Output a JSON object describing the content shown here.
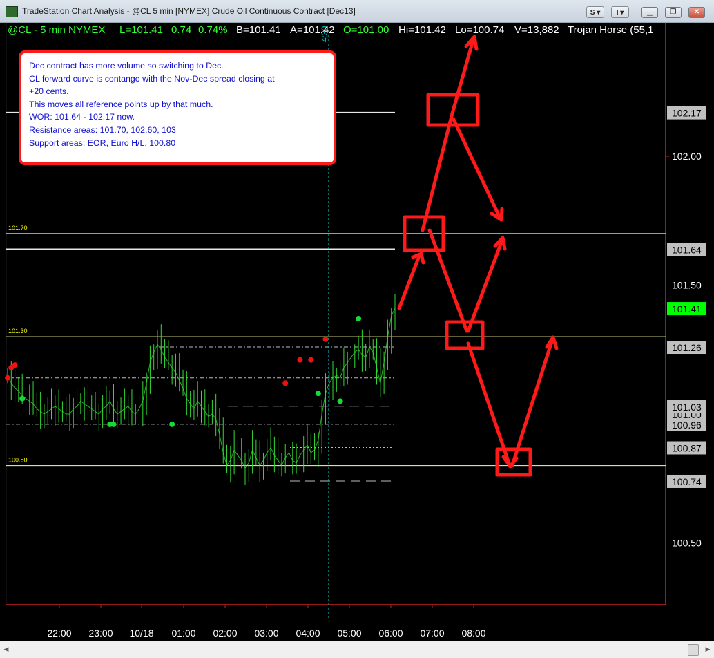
{
  "window": {
    "title": "TradeStation Chart Analysis - @CL 5 min [NYMEX] Crude Oil Continuous Contract [Dec13]",
    "s_button": "S",
    "i_button": "I"
  },
  "status_line": {
    "symbol": "@CL - 5 min  NYMEX",
    "last": "L=101.41",
    "change": "0.74",
    "change_pct": "0.74%",
    "bid": "B=101.41",
    "ask": "A=101.42",
    "open": "O=101.00",
    "high": "Hi=101.42",
    "low": "Lo=100.74",
    "volume": "V=13,882",
    "indicator": "Trojan Horse (55,1"
  },
  "note": {
    "lines": [
      "Dec contract has more volume so switching to Dec.",
      "CL forward curve is contango with the Nov-Dec spread closing at",
      "+20 cents.",
      "This moves all reference points up by that much.",
      "WOR: 101.64 - 102.17 now.",
      "Resistance areas: 101.70, 102.60, 103",
      "Support areas: EOR, Euro H/L, 100.80"
    ]
  },
  "colors": {
    "bars": "#33dd33",
    "annotation": "#ff1111",
    "level_line": "#ffff99",
    "ref_line": "#ffffff",
    "note_text": "#1010d0",
    "last_price_bg": "#00ff00",
    "time_line": "#00cccc"
  },
  "chart_data": {
    "type": "line",
    "x": [
      "22:00",
      "23:00",
      "10/18",
      "01:00",
      "02:00",
      "03:00",
      "04:00",
      "05:00",
      "06:00",
      "07:00",
      "08:00"
    ],
    "y_ticks": [
      "102.00",
      "101.50",
      "100.50"
    ],
    "ylim": [
      100.2,
      102.4
    ],
    "price_labels": [
      {
        "value": 102.17,
        "text": "102.17",
        "style": "gray"
      },
      {
        "value": 101.64,
        "text": "101.64",
        "style": "gray"
      },
      {
        "value": 101.41,
        "text": "101.41",
        "style": "green"
      },
      {
        "value": 101.26,
        "text": "101.26",
        "style": "gray"
      },
      {
        "value": 101.0,
        "text": "101.00",
        "style": "gray"
      },
      {
        "value": 101.03,
        "text": "101.03",
        "style": "gray"
      },
      {
        "value": 100.96,
        "text": "100.96",
        "style": "gray"
      },
      {
        "value": 100.87,
        "text": "100.87",
        "style": "gray"
      },
      {
        "value": 100.74,
        "text": "100.74",
        "style": "gray"
      }
    ],
    "level_lines": [
      {
        "value": 101.7,
        "label": "101.70"
      },
      {
        "value": 101.3,
        "label": "101.30"
      },
      {
        "value": 100.8,
        "label": "100.80"
      }
    ],
    "time_marker": "4:30",
    "close_path": [
      101.15,
      101.12,
      101.1,
      101.09,
      101.07,
      101.06,
      101.05,
      101.04,
      101.02,
      101.01,
      101.0,
      101.01,
      101.02,
      101.03,
      101.02,
      101.01,
      101.0,
      101.0,
      101.02,
      101.03,
      101.05,
      101.04,
      101.03,
      101.02,
      101.01,
      101.0,
      101.02,
      101.03,
      101.05,
      101.02,
      101.0,
      101.01,
      101.02,
      101.03,
      101.01,
      101.0,
      101.02,
      101.05,
      101.12,
      101.2,
      101.24,
      101.27,
      101.25,
      101.22,
      101.2,
      101.18,
      101.16,
      101.13,
      101.1,
      101.06,
      101.04,
      101.02,
      101.05,
      101.03,
      101.01,
      100.99,
      101.0,
      100.98,
      100.92,
      100.85,
      100.8,
      100.82,
      100.86,
      100.84,
      100.82,
      100.79,
      100.81,
      100.86,
      100.83,
      100.8,
      100.82,
      100.85,
      100.87,
      100.84,
      100.82,
      100.8,
      100.83,
      100.85,
      100.82,
      100.81,
      100.84,
      100.86,
      100.88,
      100.85,
      100.86,
      100.9,
      101.0,
      101.08,
      101.12,
      101.14,
      101.15,
      101.14,
      101.18,
      101.2,
      101.22,
      101.24,
      101.25,
      101.23,
      101.22,
      101.26,
      101.24,
      101.18,
      101.12,
      101.2,
      101.3,
      101.38,
      101.41
    ],
    "red_dots": [
      [
        0,
        101.14
      ],
      [
        1,
        101.18
      ],
      [
        2,
        101.19
      ],
      [
        76,
        101.12
      ],
      [
        80,
        101.21
      ],
      [
        83,
        101.21
      ],
      [
        87,
        101.29
      ]
    ],
    "green_dots": [
      [
        4,
        101.06
      ],
      [
        28,
        100.96
      ],
      [
        29,
        100.96
      ],
      [
        45,
        100.96
      ],
      [
        85,
        101.08
      ],
      [
        91,
        101.05
      ],
      [
        96,
        101.37
      ]
    ],
    "ref_lines": [
      {
        "value": 102.17,
        "style": "solid"
      },
      {
        "value": 101.64,
        "style": "solid"
      },
      {
        "value": 101.26,
        "style": "dashdot"
      },
      {
        "value": 101.14,
        "style": "dashdot"
      },
      {
        "value": 101.03,
        "style": "longdash"
      },
      {
        "value": 100.96,
        "style": "dashdot"
      },
      {
        "value": 100.87,
        "style": "dotted"
      },
      {
        "value": 100.74,
        "style": "longdash"
      }
    ]
  }
}
